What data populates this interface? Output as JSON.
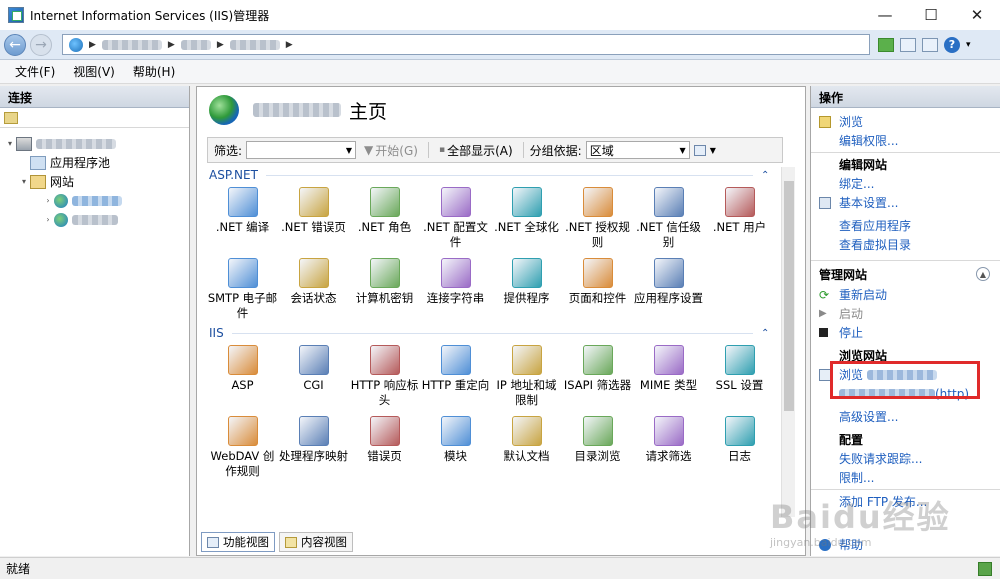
{
  "window": {
    "title": "Internet Information Services (IIS)管理器",
    "minimize": "—",
    "maximize": "☐",
    "close": "✕"
  },
  "menu": [
    "文件(F)",
    "视图(V)",
    "帮助(H)"
  ],
  "left_panel": {
    "header": "连接",
    "tree": {
      "pool": "应用程序池",
      "sites": "网站"
    }
  },
  "center": {
    "title_suffix": "主页",
    "filter_label": "筛选:",
    "start_button": "开始(G)",
    "show_all_button": "全部显示(A)",
    "group_by_label": "分组依据:",
    "group_by_value": "区域",
    "groups": [
      {
        "name": "ASP.NET",
        "features": [
          ".NET 编译",
          ".NET 错误页",
          ".NET 角色",
          ".NET 配置文件",
          ".NET 全球化",
          ".NET 授权规则",
          ".NET 信任级别",
          ".NET 用户",
          "SMTP 电子邮件",
          "会话状态",
          "计算机密钥",
          "连接字符串",
          "提供程序",
          "页面和控件",
          "应用程序设置"
        ]
      },
      {
        "name": "IIS",
        "features": [
          "ASP",
          "CGI",
          "HTTP 响应标头",
          "HTTP 重定向",
          "IP 地址和域限制",
          "ISAPI 筛选器",
          "MIME 类型",
          "SSL 设置",
          "WebDAV 创作规则",
          "处理程序映射",
          "错误页",
          "模块",
          "默认文档",
          "目录浏览",
          "请求筛选",
          "日志"
        ]
      }
    ],
    "view_tabs": [
      "功能视图",
      "内容视图"
    ]
  },
  "right_panel": {
    "header": "操作",
    "actions_top": [
      "浏览",
      "编辑权限..."
    ],
    "edit_site_header": "编辑网站",
    "edit_site": [
      "绑定...",
      "基本设置..."
    ],
    "view_links": [
      "查看应用程序",
      "查看虚拟目录"
    ],
    "manage_header": "管理网站",
    "manage": [
      "重新启动",
      "启动",
      "停止"
    ],
    "browse_header": "浏览网站",
    "browse_prefix": "浏览",
    "browse_suffix": "(http)",
    "advanced": "高级设置...",
    "config_header": "配置",
    "config": [
      "失败请求跟踪...",
      "限制..."
    ],
    "ftp": "添加 FTP 发布...",
    "help": "帮助"
  },
  "watermark": {
    "logo": "Baidu经验",
    "url": "jingyan.baidu.com"
  },
  "status": "就绪"
}
